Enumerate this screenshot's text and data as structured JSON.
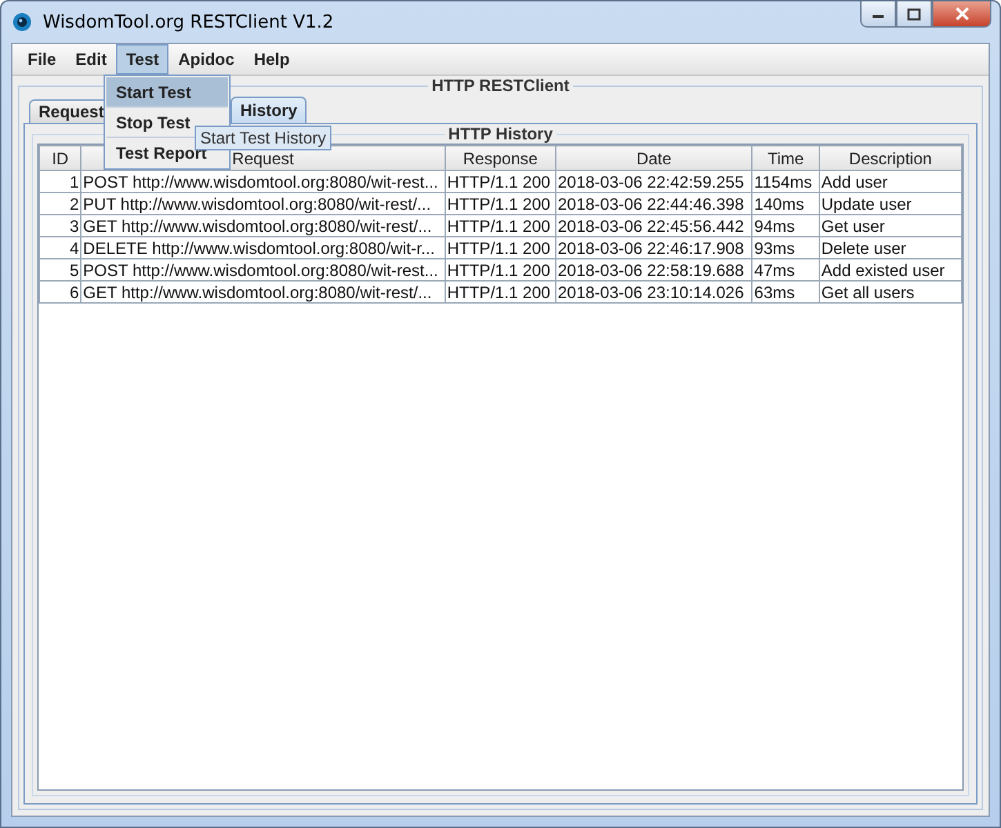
{
  "window": {
    "title": "WisdomTool.org RESTClient V1.2"
  },
  "menu": [
    {
      "label": "File",
      "selected": false
    },
    {
      "label": "Edit",
      "selected": false
    },
    {
      "label": "Test",
      "selected": true
    },
    {
      "label": "Apidoc",
      "selected": false
    },
    {
      "label": "Help",
      "selected": false
    }
  ],
  "dropdown": [
    {
      "label": "Start Test",
      "selected": true
    },
    {
      "label": "Stop Test",
      "selected": false
    },
    {
      "label": "Test Report",
      "selected": false
    }
  ],
  "tooltip": "Start Test History",
  "panel_title": "HTTP RESTClient",
  "tabs": [
    {
      "label": "Request",
      "selected": false
    },
    {
      "label": "History",
      "selected": true
    }
  ],
  "history": {
    "title": "HTTP History",
    "columns": [
      "ID",
      "Request",
      "Response",
      "Date",
      "Time",
      "Description"
    ],
    "rows": [
      [
        "1",
        "POST http://www.wisdomtool.org:8080/wit-rest...",
        "HTTP/1.1 200",
        "2018-03-06 22:42:59.255",
        "1154ms",
        "Add user"
      ],
      [
        "2",
        "PUT http://www.wisdomtool.org:8080/wit-rest/...",
        "HTTP/1.1 200",
        "2018-03-06 22:44:46.398",
        "140ms",
        "Update user"
      ],
      [
        "3",
        "GET http://www.wisdomtool.org:8080/wit-rest/...",
        "HTTP/1.1 200",
        "2018-03-06 22:45:56.442",
        "94ms",
        "Get user"
      ],
      [
        "4",
        "DELETE http://www.wisdomtool.org:8080/wit-r...",
        "HTTP/1.1 200",
        "2018-03-06 22:46:17.908",
        "93ms",
        "Delete user"
      ],
      [
        "5",
        "POST http://www.wisdomtool.org:8080/wit-rest...",
        "HTTP/1.1 200",
        "2018-03-06 22:58:19.688",
        "47ms",
        "Add existed user"
      ],
      [
        "6",
        "GET http://www.wisdomtool.org:8080/wit-rest/...",
        "HTTP/1.1 200",
        "2018-03-06 23:10:14.026",
        "63ms",
        "Get all users"
      ]
    ]
  }
}
